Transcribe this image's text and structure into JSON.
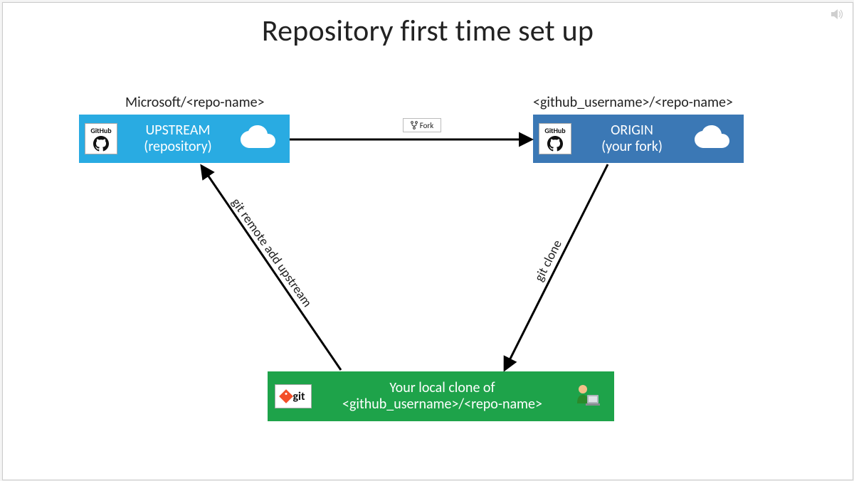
{
  "title": "Repository first time set up",
  "upstream": {
    "path_label": "Microsoft/<repo-name>",
    "line1": "UPSTREAM",
    "line2": "(repository)",
    "badge": "GitHub"
  },
  "origin": {
    "path_label": "<github_username>/<repo-name>",
    "line1": "ORIGIN",
    "line2": "(your fork)",
    "badge": "GitHub"
  },
  "local": {
    "line1": "Your local clone of",
    "line2": "<github_username>/<repo-name>",
    "badge": "git"
  },
  "fork_button": "Fork",
  "arrows": {
    "remote_add": "git remote add upstream",
    "clone": "git clone"
  },
  "colors": {
    "upstream": "#29abe2",
    "origin": "#3b78b5",
    "local": "#1ea34a"
  }
}
